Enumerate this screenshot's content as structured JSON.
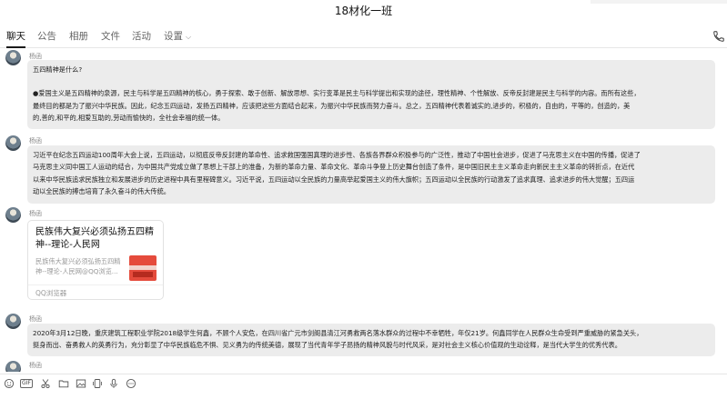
{
  "window": {
    "title": "18材化一班"
  },
  "tabs": [
    {
      "label": "聊天"
    },
    {
      "label": "公告"
    },
    {
      "label": "相册"
    },
    {
      "label": "文件"
    },
    {
      "label": "活动"
    },
    {
      "label": "设置"
    }
  ],
  "header_icons": {
    "call": "phone-icon",
    "settings_dropdown": "chevron-down-icon"
  },
  "messages": [
    {
      "sender": "杨函",
      "lines": [
        "五四精神是什么?",
        "●爱国主义是五四精神的泉源，民主与科学是五四精神的核心，勇于探索、敢于创新、解放思想、实行变革是民主与科学提出和实现的途径，理性精神、个性解放、反帝反封建是民主与科学的内容。而所有这些，",
        "最终目的都是为了振兴中华民族。因此，纪念五四运动，发扬五四精神，应该把这些方面结合起来，为振兴中华民族而努力奋斗。总之，五四精神代表着诚实的,进步的，积极的，自由的，平等的，创造的，美",
        "的,善的,和平的,相爱互助的,劳动而愉快的，全社会幸福的统一体。"
      ]
    },
    {
      "sender": "杨函",
      "lines": [
        "习近平在纪念五四运动100周年大会上说，五四运动，以彻底反帝反封建的革命性、追求救国强国真理的进步性、各族各界群众积极参与的广泛性，推动了中国社会进步，促进了马克思主义在中国的传播，促进了",
        "马克思主义同中国工人运动的结合，为中国共产党成立做了思想上干部上的准备，为新的革命力量、革命文化、革命斗争登上历史舞台创造了条件，是中国旧民主主义革命走向新民主主义革命的转折点，在近代",
        "以来中华民族追求民族独立和发展进步的历史进程中具有里程碑意义。习近平说，五四运动以全民族的力量高举起爱国主义的伟大旗帜；五四运动以全民族的行动激发了追求真理、追求进步的伟大觉醒；五四运",
        "动以全民族的搏击培育了永久奋斗的伟大传统。"
      ]
    },
    {
      "sender": "杨函",
      "card": {
        "title": "民族伟大复兴必须弘扬五四精神--理论-人民网",
        "desc": "民族伟大复兴必须弘扬五四精神--理论-人民网@QQ浏览...",
        "source": "QQ浏览器"
      }
    },
    {
      "sender": "杨函",
      "lines": [
        "2020年3月12日晚，重庆建筑工程职业学院2018级学生何鑫，不顾个人安危，在四川省广元市剑阁县清江河勇救两名落水群众的过程中不幸牺牲，年仅21岁。何鑫同学在人民群众生命受到严重威胁的紧急关头，",
        "挺身而出、奋勇救人的英勇行为，充分彰显了中华民族临危不惧、见义勇为的传统美德，展现了当代青年学子昂扬的精神风貌与时代风采，是对社会主义核心价值观的生动诠释，是当代大学生的优秀代表。"
      ]
    },
    {
      "sender": "杨函"
    }
  ],
  "toolbar": {
    "icons": [
      "smiley-icon",
      "gif-icon",
      "scissors-icon",
      "folder-icon",
      "image-icon",
      "shake-icon",
      "microphone-icon",
      "more-icon"
    ],
    "gif_label": "GIF"
  }
}
